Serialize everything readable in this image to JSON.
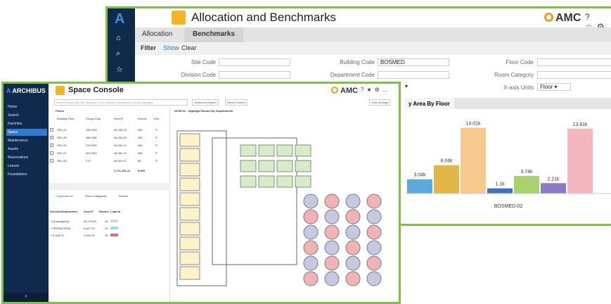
{
  "back": {
    "title": "Allocation and Benchmarks",
    "brand": "AMC",
    "tabs": [
      "Allocation",
      "Benchmarks"
    ],
    "filter": {
      "label": "Filter",
      "show": "Show",
      "clear": "Clear"
    },
    "fields": [
      {
        "label": "Site Code",
        "value": ""
      },
      {
        "label": "Building Code",
        "value": "BOSMED"
      },
      {
        "label": "Floor Code",
        "value": ""
      },
      {
        "label": "Division Code",
        "value": ""
      },
      {
        "label": "Department Code",
        "value": ""
      },
      {
        "label": "Room Category",
        "value": ""
      }
    ],
    "xaxis_label": "X-axis Units",
    "xaxis_value": "Floor",
    "chart_tab": "y Area By Floor",
    "chart_data": {
      "type": "bar",
      "categories": [
        "BOSMED-02"
      ],
      "xlabel": "BOSMED-02",
      "series": [
        {
          "value": 3.04,
          "label": "3.04k",
          "color": "#5aa9df"
        },
        {
          "value": 6.04,
          "label": "6.04k",
          "color": "#e3b648"
        },
        {
          "value": 14.01,
          "label": "14.01k",
          "color": "#f7c98f"
        },
        {
          "value": 1.1,
          "label": "1.1k",
          "color": "#3d71c4"
        },
        {
          "value": 3.74,
          "label": "3.74k",
          "color": "#a8d26e"
        },
        {
          "value": 2.21,
          "label": "2.21k",
          "color": "#8b7bc6"
        },
        {
          "value": 13.81,
          "label": "13.81k",
          "color": "#f6b6be"
        }
      ]
    }
  },
  "front": {
    "brand": "ARCHIBUS",
    "title": "Space Console",
    "amc": "AMC",
    "nav": [
      "Home",
      "Search",
      "Favorites",
      "Space",
      "Maintenance",
      "Assets",
      "Reservations",
      "Leases",
      "Foundations"
    ],
    "search_placeholder": "Search Rooms By Site, Building, Floor, Division, Department, Room Category",
    "advanced": "Advanced Search",
    "recent": "Recent Search",
    "view_settings": "View Settings",
    "floors_tab": "Floors",
    "floor_headers": [
      "Building-Floor",
      "Occup./Cap.",
      "Area ft²",
      "Rooms",
      "Edit"
    ],
    "floors": [
      [
        "SRL-04",
        "198 /294",
        "46,264.13",
        "364"
      ],
      [
        "SRL-05",
        "288 /288",
        "46,264.00",
        "362"
      ],
      [
        "SRL-06",
        "210 /295",
        "46,264.14",
        "364"
      ],
      [
        "SRL-07",
        "303 /303",
        "46,281.72",
        "365"
      ],
      [
        "SRL-B1",
        "0 /0",
        "46,091.07",
        "68"
      ]
    ],
    "floor_totals": [
      "1,721,181.12",
      "8,529"
    ],
    "lower_tabs": [
      "Organizations",
      "Room Categories",
      "Rooms"
    ],
    "org_headers": [
      "Division/Department",
      "Area ft²",
      "Rooms",
      "Legend"
    ],
    "orgs": [
      {
        "name": "[Unassigned]",
        "area": "26,179.69",
        "rooms": "46",
        "color": "#d9d9d9"
      },
      {
        "name": "OPERATIONS",
        "area": "8,607.25",
        "rooms": "29",
        "color": "#8fe3ee"
      },
      {
        "name": "R AND D",
        "area": "4,590.25",
        "rooms": "33",
        "color": "#e86b6b"
      }
    ],
    "plan_title": "NC05-02 - Highlight Rooms By Departments"
  }
}
